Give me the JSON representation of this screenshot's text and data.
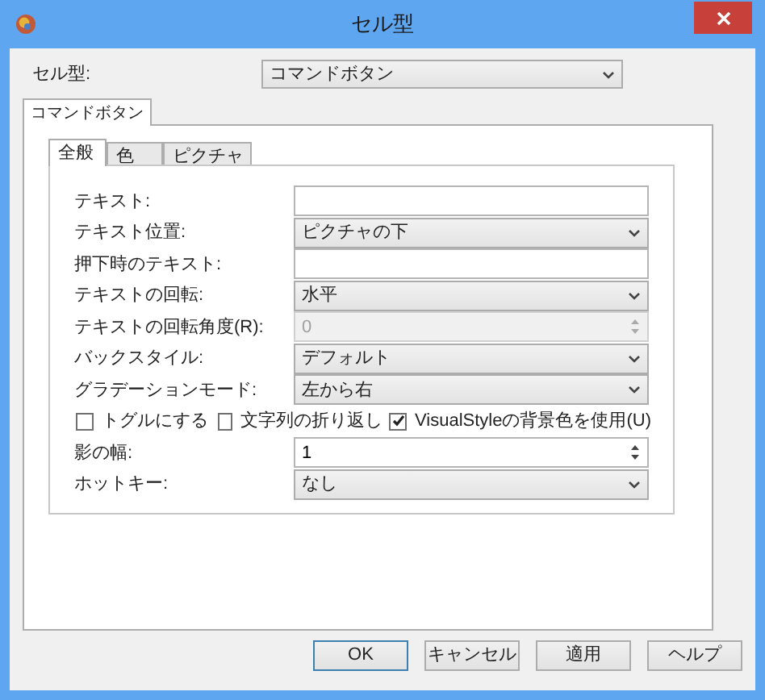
{
  "window": {
    "title": "セル型"
  },
  "cell_type": {
    "label": "セル型:",
    "value": "コマンドボタン"
  },
  "outer_tabs": [
    {
      "label": "コマンドボタン",
      "selected": true
    }
  ],
  "inner_tabs": [
    {
      "label": "全般",
      "selected": true
    },
    {
      "label": "色",
      "selected": false
    },
    {
      "label": "ピクチャ",
      "selected": false
    }
  ],
  "fields_top": [
    {
      "label": "テキスト:",
      "kind": "text"
    },
    {
      "label": "テキスト位置:",
      "kind": "combo",
      "value": "ピクチャの下"
    },
    {
      "label": "押下時のテキスト:",
      "kind": "text"
    },
    {
      "label": "テキストの回転:",
      "kind": "combo",
      "value": "水平"
    },
    {
      "label": "テキストの回転角度(R):",
      "kind": "spin",
      "value": "0",
      "disabled": true
    },
    {
      "label": "バックスタイル:",
      "kind": "combo",
      "value": "デフォルト"
    },
    {
      "label": "グラデーションモード:",
      "kind": "combo",
      "value": "左から右"
    }
  ],
  "checkboxes": [
    {
      "label": "トグルにする",
      "checked": false
    },
    {
      "label": "文字列の折り返し",
      "checked": false
    },
    {
      "label": "VisualStyleの背景色を使用(U)",
      "checked": true
    }
  ],
  "fields_bottom": [
    {
      "label": "影の幅:",
      "kind": "spin",
      "value": "1",
      "disabled": false
    },
    {
      "label": "ホットキー:",
      "kind": "combo",
      "value": "なし"
    }
  ],
  "buttons": [
    "OK",
    "キャンセル",
    "適用",
    "ヘルプ"
  ]
}
